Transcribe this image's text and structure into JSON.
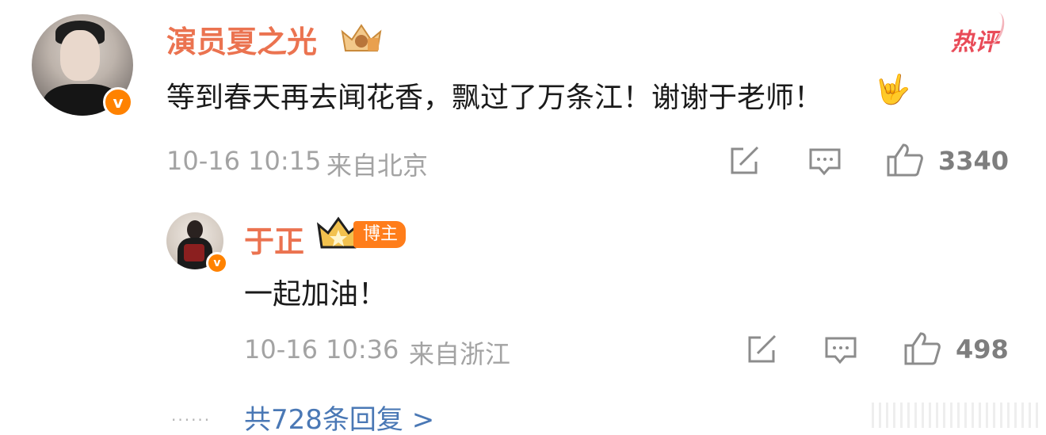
{
  "main_comment": {
    "username": "演员夏之光",
    "badge": "热评",
    "text": "等到春天再去闻花香，飘过了万条江！谢谢于老师！",
    "emoji": "🤟",
    "time": "10-16 10:15",
    "location": "来自北京",
    "likes": "3340",
    "verified_mark": "v"
  },
  "reply": {
    "username": "于正",
    "role_badge": "博主",
    "text": "一起加油！",
    "time": "10-16 10:36",
    "location": "来自浙江",
    "likes": "498",
    "verified_mark": "v"
  },
  "footer": {
    "dots": "......",
    "more_replies": "共728条回复 >"
  },
  "colors": {
    "username": "#eb7350",
    "hot": "#e94b58",
    "verified": "#ff8200",
    "link": "#4a78b5",
    "meta": "#a3a3a3"
  },
  "icons": [
    "share-icon",
    "comment-icon",
    "like-icon",
    "crown-icon"
  ]
}
